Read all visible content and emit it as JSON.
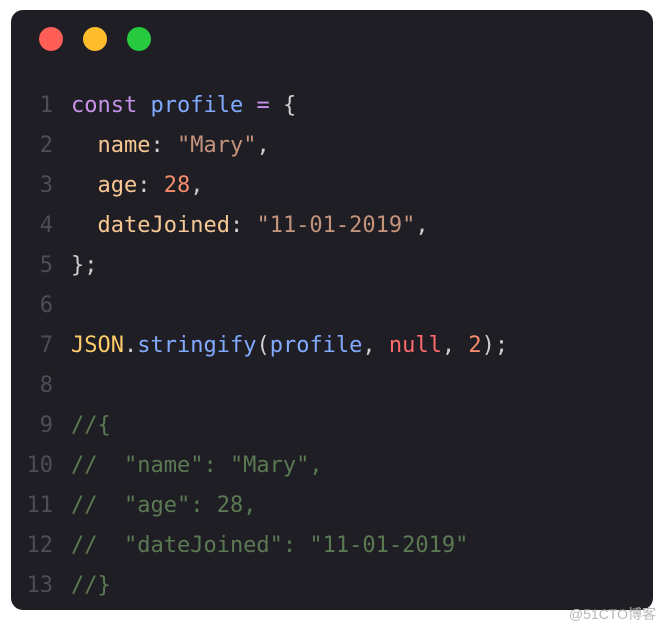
{
  "window": {
    "dots": [
      "red",
      "yellow",
      "green"
    ]
  },
  "code": {
    "lines": [
      {
        "n": "1",
        "tokens": [
          {
            "t": "const ",
            "c": "kw"
          },
          {
            "t": "profile",
            "c": "var"
          },
          {
            "t": " ",
            "c": "punct"
          },
          {
            "t": "=",
            "c": "kw"
          },
          {
            "t": " ",
            "c": "punct"
          },
          {
            "t": "{",
            "c": "punct"
          }
        ]
      },
      {
        "n": "2",
        "tokens": [
          {
            "t": "  ",
            "c": "punct"
          },
          {
            "t": "name",
            "c": "prop"
          },
          {
            "t": ": ",
            "c": "punct"
          },
          {
            "t": "\"Mary\"",
            "c": "str"
          },
          {
            "t": ",",
            "c": "punct"
          }
        ]
      },
      {
        "n": "3",
        "tokens": [
          {
            "t": "  ",
            "c": "punct"
          },
          {
            "t": "age",
            "c": "prop"
          },
          {
            "t": ": ",
            "c": "punct"
          },
          {
            "t": "28",
            "c": "num"
          },
          {
            "t": ",",
            "c": "punct"
          }
        ]
      },
      {
        "n": "4",
        "tokens": [
          {
            "t": "  ",
            "c": "punct"
          },
          {
            "t": "dateJoined",
            "c": "prop"
          },
          {
            "t": ": ",
            "c": "punct"
          },
          {
            "t": "\"11-01-2019\"",
            "c": "str"
          },
          {
            "t": ",",
            "c": "punct"
          }
        ]
      },
      {
        "n": "5",
        "tokens": [
          {
            "t": "};",
            "c": "punct"
          }
        ]
      },
      {
        "n": "6",
        "tokens": [
          {
            "t": "",
            "c": "punct"
          }
        ]
      },
      {
        "n": "7",
        "tokens": [
          {
            "t": "JSON",
            "c": "type"
          },
          {
            "t": ".",
            "c": "punct"
          },
          {
            "t": "stringify",
            "c": "fn"
          },
          {
            "t": "(",
            "c": "punct"
          },
          {
            "t": "profile",
            "c": "var"
          },
          {
            "t": ", ",
            "c": "punct"
          },
          {
            "t": "null",
            "c": "null"
          },
          {
            "t": ", ",
            "c": "punct"
          },
          {
            "t": "2",
            "c": "num"
          },
          {
            "t": ");",
            "c": "punct"
          }
        ]
      },
      {
        "n": "8",
        "tokens": [
          {
            "t": "",
            "c": "punct"
          }
        ]
      },
      {
        "n": "9",
        "tokens": [
          {
            "t": "//{",
            "c": "comment"
          }
        ]
      },
      {
        "n": "10",
        "tokens": [
          {
            "t": "//  \"name\": \"Mary\",",
            "c": "comment"
          }
        ]
      },
      {
        "n": "11",
        "tokens": [
          {
            "t": "//  \"age\": 28,",
            "c": "comment"
          }
        ]
      },
      {
        "n": "12",
        "tokens": [
          {
            "t": "//  \"dateJoined\": \"11-01-2019\"",
            "c": "comment"
          }
        ]
      },
      {
        "n": "13",
        "tokens": [
          {
            "t": "//}",
            "c": "comment"
          }
        ]
      }
    ]
  },
  "watermark": "@51CTO博客"
}
